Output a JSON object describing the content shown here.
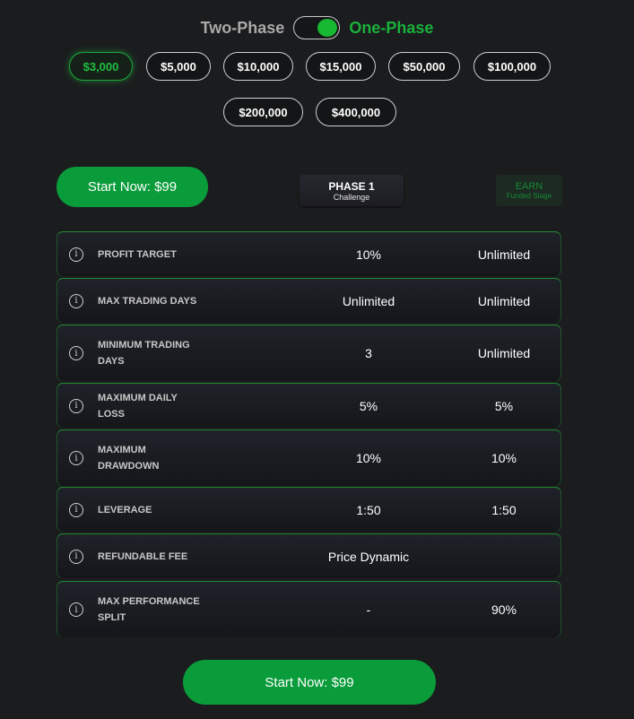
{
  "toggle": {
    "left_label": "Two-Phase",
    "right_label": "One-Phase",
    "state": "One-Phase"
  },
  "amounts": {
    "selected": "$3,000",
    "options": [
      "$3,000",
      "$5,000",
      "$10,000",
      "$15,000",
      "$50,000",
      "$100,000",
      "$200,000",
      "$400,000"
    ]
  },
  "start_top_label": "Start Now: $99",
  "start_bottom_label": "Start Now: $99",
  "stages": {
    "phase1": {
      "title": "PHASE 1",
      "subtitle": "Challenge"
    },
    "earn": {
      "title": "EARN",
      "subtitle": "Funded Stage"
    }
  },
  "rows": [
    {
      "label": "PROFIT TARGET",
      "phase1": "10%",
      "earn": "Unlimited"
    },
    {
      "label": "MAX TRADING DAYS",
      "phase1": "Unlimited",
      "earn": "Unlimited"
    },
    {
      "label": "MINIMUM TRADING DAYS",
      "phase1": "3",
      "earn": "Unlimited"
    },
    {
      "label": "MAXIMUM DAILY LOSS",
      "phase1": "5%",
      "earn": "5%"
    },
    {
      "label": "MAXIMUM DRAWDOWN",
      "phase1": "10%",
      "earn": "10%"
    },
    {
      "label": "LEVERAGE",
      "phase1": "1:50",
      "earn": "1:50"
    },
    {
      "label": "REFUNDABLE FEE",
      "phase1": "Price Dynamic",
      "earn": ""
    },
    {
      "label": "MAX PERFORMANCE SPLIT",
      "phase1": "-",
      "earn": "90%"
    }
  ],
  "colors": {
    "accent_green": "#0a9b3a",
    "active_green": "#19b13a",
    "background": "#1b1c1e"
  }
}
